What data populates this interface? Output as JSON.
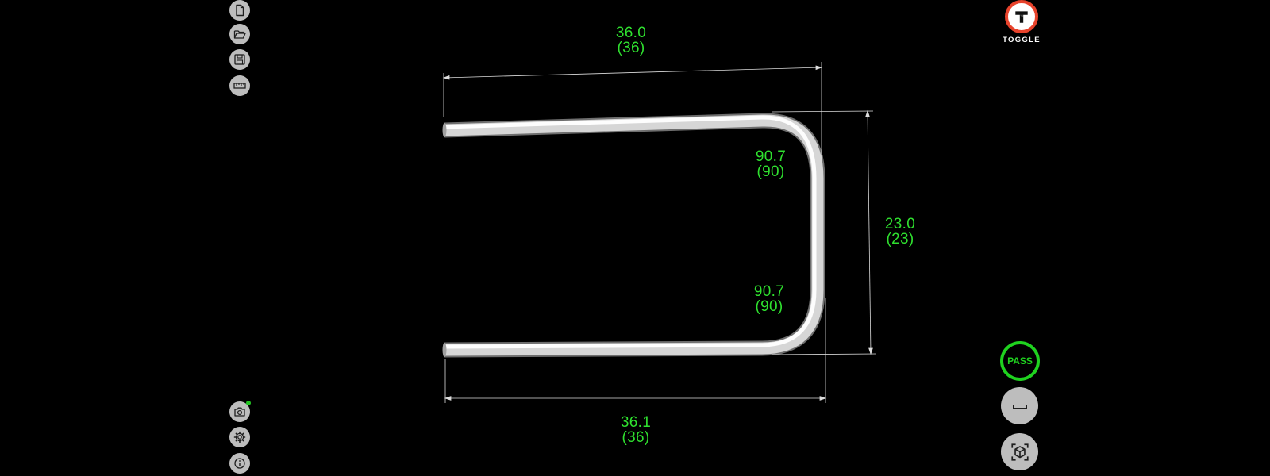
{
  "colors": {
    "background": "#000000",
    "dimension_text": "#2fe02f",
    "dimension_line": "#dddddd",
    "button_bg": "#bdbdbd",
    "icon": "#1e1e1e",
    "brand": "#e8432c",
    "pass": "#1fd21f",
    "status_dot": "#22c322"
  },
  "toolbar_left_top": [
    {
      "name": "new-file",
      "icon": "file-icon"
    },
    {
      "name": "open-folder",
      "icon": "folder-open-icon"
    },
    {
      "name": "save",
      "icon": "save-icon"
    },
    {
      "name": "measure",
      "icon": "ruler-icon"
    }
  ],
  "toolbar_left_bottom": [
    {
      "name": "camera",
      "icon": "camera-icon",
      "status_indicator": true
    },
    {
      "name": "settings",
      "icon": "gear-icon"
    },
    {
      "name": "info",
      "icon": "info-icon"
    }
  ],
  "logo": {
    "letter": "T",
    "text": "TOGGLE"
  },
  "status": {
    "label": "PASS"
  },
  "dimensions": {
    "top_length": {
      "measured": "36.0",
      "nominal": "(36)"
    },
    "upper_bend_angle": {
      "measured": "90.7",
      "nominal": "(90)"
    },
    "right_height": {
      "measured": "23.0",
      "nominal": "(23)"
    },
    "lower_bend_angle": {
      "measured": "90.7",
      "nominal": "(90)"
    },
    "bottom_length": {
      "measured": "36.1",
      "nominal": "(36)"
    }
  },
  "right_controls": [
    {
      "name": "flat-view",
      "icon": "flat-view-icon"
    },
    {
      "name": "3d-view",
      "icon": "3d-cube-icon"
    }
  ]
}
